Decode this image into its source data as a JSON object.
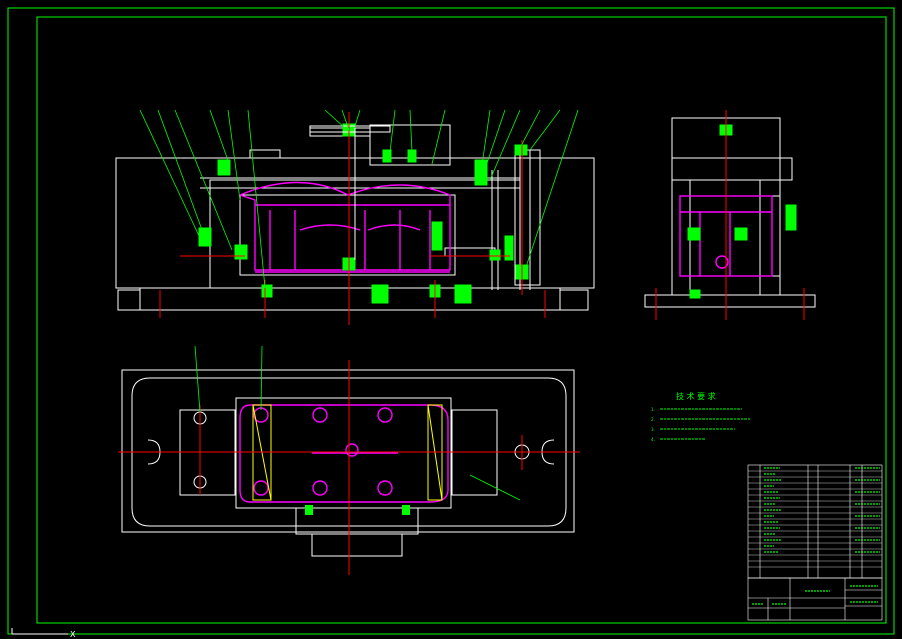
{
  "colors": {
    "background": "#000000",
    "frame": "#00ff00",
    "outline": "#ffffff",
    "part": "#ff00ff",
    "centerline": "#ff0000",
    "hatch": "#00ff00",
    "leader": "#00ff00",
    "highlight": "#ffff00"
  },
  "technical_requirements": {
    "title": "技 术 要 求",
    "items": [
      "1.  ",
      "2.  ",
      "3.  ",
      "4.  "
    ]
  },
  "title_block": {
    "drawing_title": ""
  },
  "views": [
    "front-view",
    "side-view",
    "top-view"
  ]
}
